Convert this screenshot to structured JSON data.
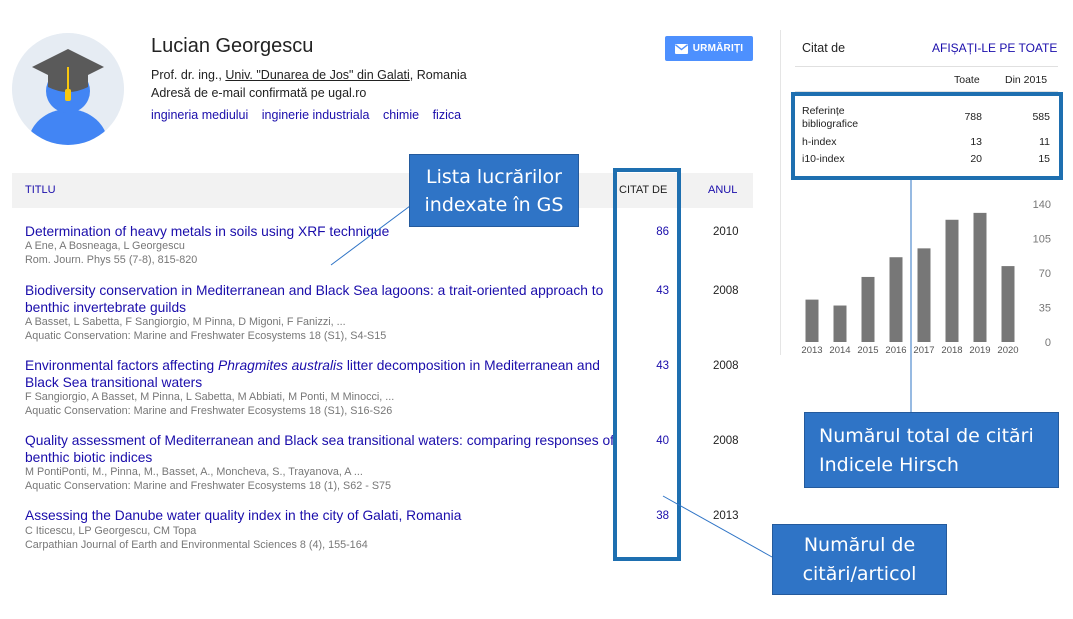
{
  "profile": {
    "name": "Lucian Georgescu",
    "title_prefix": "Prof. dr. ing., ",
    "university": "Univ. \"Dunarea de Jos\" din Galati",
    "country": ", Romania",
    "email_text": "Adresă de e-mail confirmată pe ugal.ro",
    "interests": [
      "ingineria mediului",
      "inginerie industriala",
      "chimie",
      "fizica"
    ],
    "follow_label": "URMĂRIȚI"
  },
  "table": {
    "col_title": "TITLU",
    "col_cited": "CITAT DE",
    "col_year": "ANUL"
  },
  "articles": [
    {
      "title": "Determination of heavy metals in soils using XRF technique",
      "authors": "A Ene, A Bosneaga, L Georgescu",
      "publication": "Rom. Journ. Phys 55 (7-8), 815-820",
      "cited": "86",
      "year": "2010"
    },
    {
      "title": "Biodiversity conservation in Mediterranean and Black Sea lagoons: a trait-oriented approach to benthic invertebrate guilds",
      "authors": "A Basset, L Sabetta, F Sangiorgio, M Pinna, D Migoni, F Fanizzi, ...",
      "publication": "Aquatic Conservation: Marine and Freshwater Ecosystems 18 (S1), S4-S15",
      "cited": "43",
      "year": "2008"
    },
    {
      "title_part1": "Environmental factors affecting ",
      "title_italic": "Phragmites australis",
      "title_part2": " litter decomposition in Mediterranean and Black Sea transitional waters",
      "authors": "F Sangiorgio, A Basset, M Pinna, L Sabetta, M Abbiati, M Ponti, M Minocci, ...",
      "publication": "Aquatic Conservation: Marine and Freshwater Ecosystems 18 (S1), S16-S26",
      "cited": "43",
      "year": "2008"
    },
    {
      "title": "Quality assessment of Mediterranean and Black sea transitional waters: comparing responses of benthic biotic indices",
      "authors": "M PontiPonti, M., Pinna, M., Basset, A., Moncheva, S., Trayanova, A ...",
      "publication": "Aquatic Conservation: Marine and Freshwater Ecosystems 18 (1), S62 - S75",
      "cited": "40",
      "year": "2008"
    },
    {
      "title": "Assessing the Danube water quality index in the city of Galati, Romania",
      "authors": "C Iticescu, LP Georgescu, CM Topa",
      "publication": "Carpathian Journal of Earth and Environmental Sciences 8 (4), 155-164",
      "cited": "38",
      "year": "2013"
    }
  ],
  "citations_panel": {
    "heading": "Citat de",
    "show_all": "AFIȘAȚI-LE PE TOATE",
    "col_all": "Toate",
    "col_since": "Din 2015",
    "rows": [
      {
        "label_line1": "Referințe",
        "label_line2": "bibliografice",
        "all": "788",
        "since": "585"
      },
      {
        "label": "h-index",
        "all": "13",
        "since": "11"
      },
      {
        "label": "i10-index",
        "all": "20",
        "since": "15"
      }
    ]
  },
  "chart_data": {
    "type": "bar",
    "categories": [
      "2013",
      "2014",
      "2015",
      "2016",
      "2017",
      "2018",
      "2019",
      "2020"
    ],
    "values": [
      43,
      37,
      66,
      86,
      95,
      124,
      131,
      77
    ],
    "ylim": [
      0,
      140
    ],
    "yticks": [
      "140",
      "105",
      "70",
      "35",
      "0"
    ],
    "bar_color": "#777777"
  },
  "annotations": {
    "list_label_line1": "Lista lucrărilor",
    "list_label_line2": "indexate în GS",
    "total_label_line1": "Numărul total de citări",
    "total_label_line2": "Indicele Hirsch",
    "per_article_line1": "Numărul de",
    "per_article_line2": "citări/articol"
  },
  "colors": {
    "link": "#1a0dab",
    "highlight": "#1e6fb0",
    "callout_bg": "#2f74c6",
    "button": "#4d90fe"
  }
}
